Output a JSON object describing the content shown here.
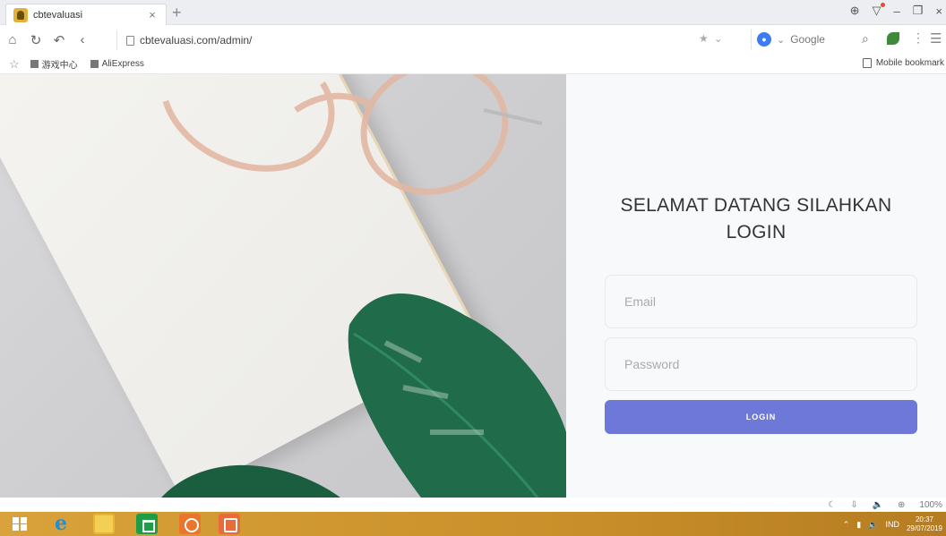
{
  "browser": {
    "tab": {
      "title": "cbtevaluasi",
      "close_icon": "close-icon"
    },
    "url": "cbtevaluasi.com/admin/",
    "search_engine": "Google",
    "bookmarks": [
      {
        "label": "游戏中心"
      },
      {
        "label": "AliExpress"
      }
    ],
    "mobile_bookmarks": "Mobile bookmark"
  },
  "login": {
    "welcome_text": "SELAMAT DATANG SILAHKAN LOGIN",
    "email_placeholder": "Email",
    "password_placeholder": "Password",
    "button_label": "LOGIN"
  },
  "status": {
    "zoom": "100%"
  },
  "taskbar": {
    "language": "IND",
    "time": "20:37",
    "date": "29/07/2019"
  },
  "colors": {
    "login_button": "#6e78d8",
    "taskbar": "#d9a23a"
  }
}
